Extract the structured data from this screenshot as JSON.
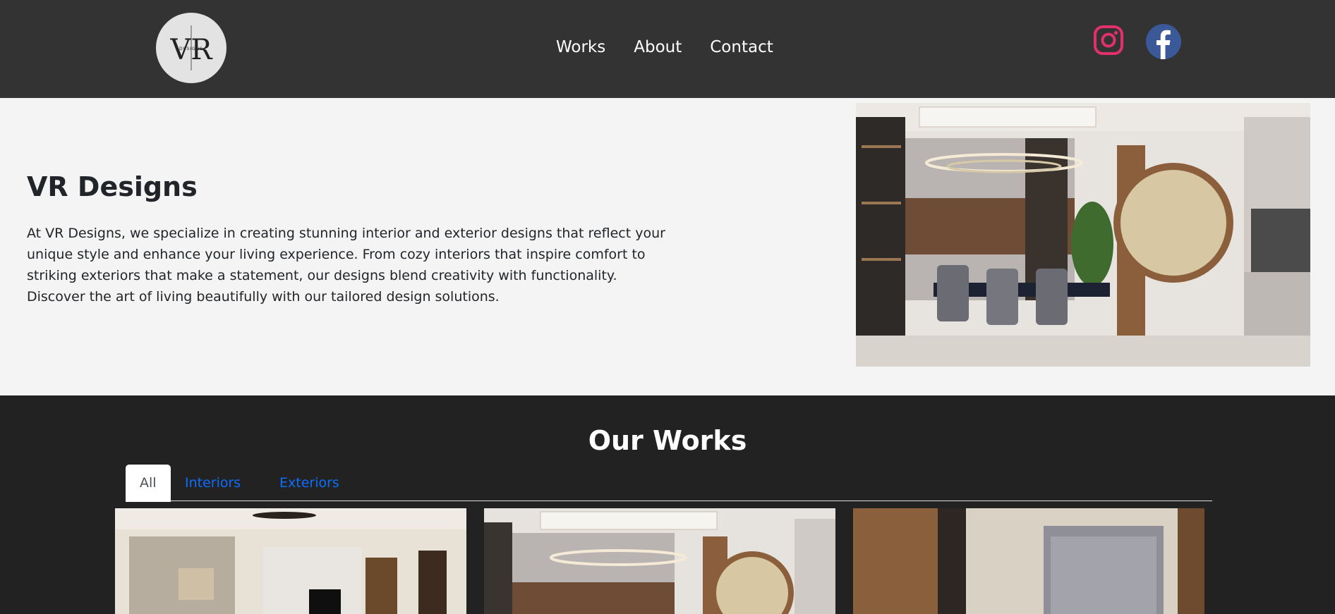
{
  "header": {
    "logo_text": "VR",
    "logo_subtext": "DESIGNS",
    "nav": [
      {
        "label": "Works"
      },
      {
        "label": "About"
      },
      {
        "label": "Contact"
      }
    ],
    "social": [
      {
        "icon": "instagram-icon",
        "color": "#e1306c"
      },
      {
        "icon": "facebook-icon",
        "color": "#3b5998"
      }
    ]
  },
  "hero": {
    "title": "VR Designs",
    "description": "At VR Designs, we specialize in creating stunning interior and exterior designs that reflect your unique style and enhance your living experience. From cozy interiors that inspire comfort to striking exteriors that make a statement, our designs blend creativity with functionality. Discover the art of living beautifully with our tailored design solutions."
  },
  "works": {
    "title": "Our Works",
    "tabs": [
      {
        "label": "All",
        "active": true
      },
      {
        "label": "Interiors",
        "active": false
      },
      {
        "label": "Exteriors",
        "active": false
      }
    ]
  },
  "colors": {
    "header_bg": "#333333",
    "hero_bg": "#f4f4f4",
    "works_bg": "#222222",
    "link": "#0d6efd"
  }
}
